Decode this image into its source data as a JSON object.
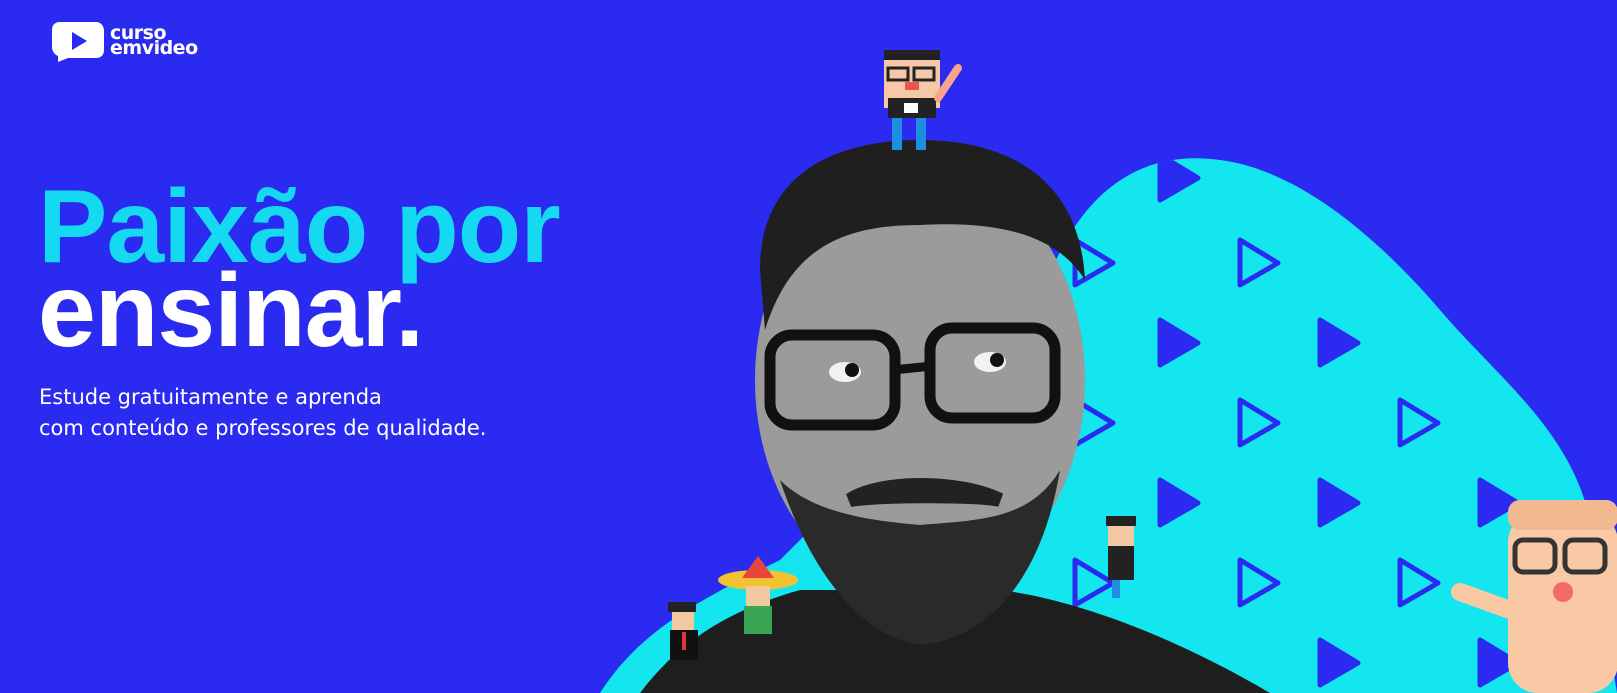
{
  "logo": {
    "line1": "curso",
    "line2": "emvideo",
    "icon": "play-badge-icon"
  },
  "hero": {
    "title_line1": "Paixão por",
    "title_line2": "ensinar.",
    "subtitle_line1": "Estude gratuitamente e aprenda",
    "subtitle_line2": "com conteúdo e professores de qualidade."
  },
  "colors": {
    "background": "#2a2af0",
    "accent": "#14d9f0",
    "text": "#ffffff"
  }
}
